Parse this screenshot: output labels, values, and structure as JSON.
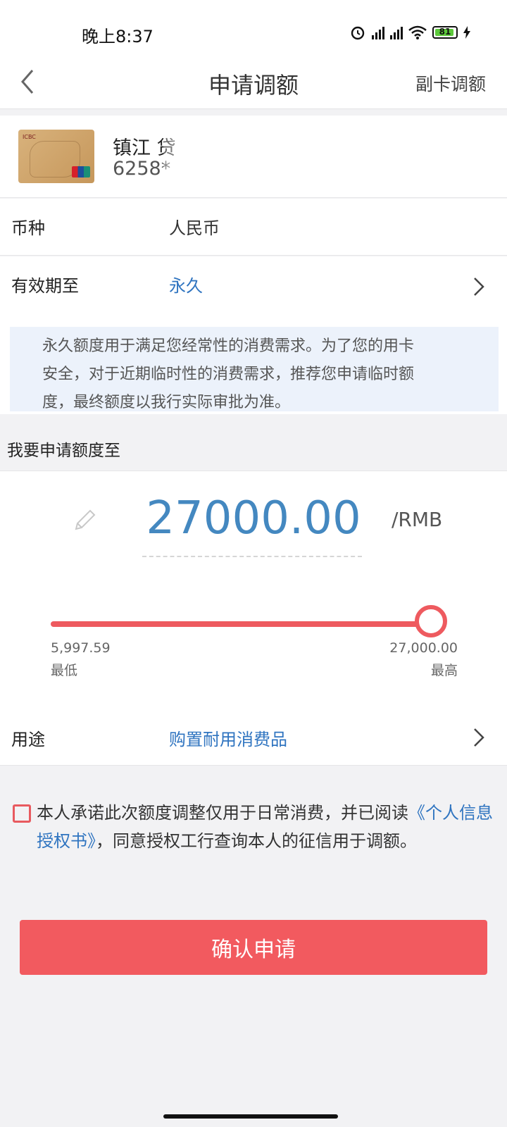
{
  "status": {
    "time": "晚上8:37",
    "battery": "81"
  },
  "nav": {
    "title": "申请调额",
    "right_action": "副卡调额"
  },
  "card": {
    "name": "镇江 贷",
    "number": "6258*"
  },
  "rows": {
    "currency_label": "币种",
    "currency_value": "人民币",
    "validity_label": "有效期至",
    "validity_value": "永久",
    "purpose_label": "用途",
    "purpose_value": "购置耐用消费品"
  },
  "notice": {
    "lines": [
      "永久额度用于满足您经常性的消费需求。为了您的用卡",
      "安全，对于近期临时性的消费需求，推荐您申请临时额",
      "度，最终额度以我行实际审批为准。"
    ]
  },
  "amount_section": {
    "title": "我要申请额度至",
    "amount": "27000.00",
    "unit": "/RMB",
    "min_value": "5,997.59",
    "min_label": "最低",
    "max_value": "27,000.00",
    "max_label": "最高",
    "slider_fraction": 1.0
  },
  "agreement": {
    "text_before": "本人承诺此次额度调整仅用于日常消费，并已阅读",
    "link": "《个人信息授权书》",
    "text_after": "，同意授权工行查询本人的征信用于调额。"
  },
  "confirm_label": "确认申请",
  "colors": {
    "accent": "#f25a5f",
    "link": "#2f74c0",
    "amount": "#4488c0"
  }
}
